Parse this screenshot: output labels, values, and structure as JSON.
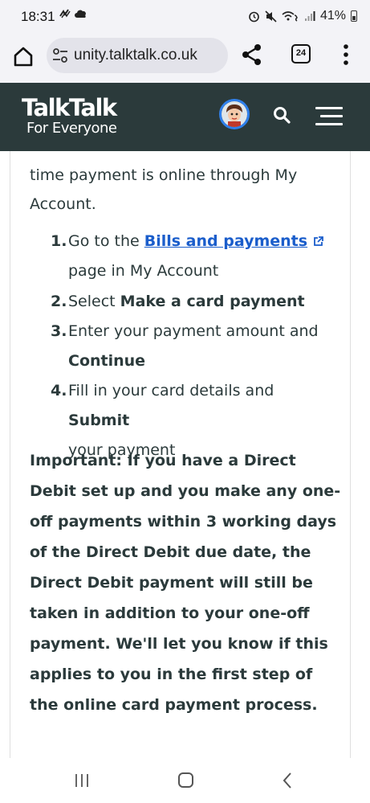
{
  "status_bar": {
    "time": "18:31",
    "battery_text": "41%",
    "left_icons": [
      "sync-icon",
      "cloud-icon"
    ],
    "right_icons": [
      "alarm-icon",
      "mute-icon",
      "wifi-call-icon",
      "signal-icon",
      "battery-icon"
    ]
  },
  "browser": {
    "url": "unity.talktalk.co.uk",
    "tab_count": "24"
  },
  "header": {
    "logo_main": "TalkTalk",
    "logo_sub": "For Everyone"
  },
  "content": {
    "intro": "time payment is online through My Account.",
    "steps": [
      {
        "num": "1.",
        "line1_pre": "Go to the ",
        "link": "Bills and payments",
        "line2": "page in My Account"
      },
      {
        "num": "2.",
        "pre": "Select ",
        "bold": "Make a card payment"
      },
      {
        "num": "3.",
        "pre": "Enter your payment amount and",
        "bold": "Continue"
      },
      {
        "num": "4.",
        "pre": "Fill in your card details and ",
        "bold": "Submit",
        "line2": "your payment"
      }
    ],
    "important": "Important: If you have a Direct Debit set up and you make any one-off payments within 3 working days of the Direct Debit due date, the Direct Debit payment will still be taken in addition to your one-off payment. We'll let you know if this applies to you in the first step of the online card payment process."
  },
  "colors": {
    "header_bg": "#2b3a3b",
    "link": "#1a5dcb",
    "text": "#2b3a3b",
    "avatar_ring": "#2f80ed"
  }
}
